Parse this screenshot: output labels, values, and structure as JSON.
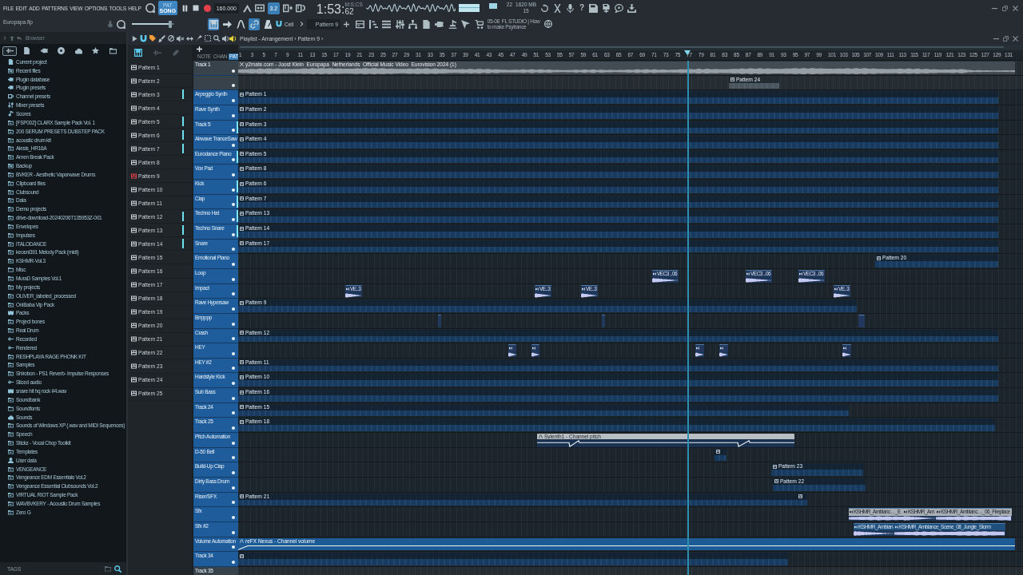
{
  "menu": [
    "FILE",
    "EDIT",
    "ADD",
    "PATTERNS",
    "VIEW",
    "OPTIONS",
    "TOOLS",
    "HELP"
  ],
  "transport": {
    "modes": [
      {
        "label": "PAT",
        "selected": false
      },
      {
        "label": "SONG",
        "selected": true
      }
    ],
    "tempo": "160.000",
    "toggle": {
      "label": "3.2",
      "on": true
    },
    "time": {
      "main": "1:53:",
      "fraction": "62",
      "unit": "M:S:CS"
    },
    "cpu": "22",
    "memory": "1620 MB",
    "voices": "15",
    "help": "?"
  },
  "project": {
    "file": "Europapa.flp",
    "master_volume": {
      "level": 0.9
    },
    "tools": [
      {
        "kind": "keyboard",
        "on": true
      },
      {
        "kind": "arrow",
        "on": false
      },
      {
        "kind": "curve",
        "on": false
      },
      {
        "kind": "link",
        "on": true
      },
      {
        "kind": "metronome",
        "on": false
      }
    ],
    "snap": "Cell",
    "pattern": "Pattern 9",
    "hint": [
      "05-08  FL STUDIO | How",
      "to make Psytrance"
    ]
  },
  "browser": {
    "title": "Browser",
    "tabs": [
      {
        "kind": "all",
        "selected": true
      },
      {
        "kind": "file",
        "selected": false
      },
      {
        "kind": "plug",
        "selected": false
      },
      {
        "kind": "disc",
        "selected": false
      },
      {
        "kind": "cloud",
        "selected": false
      },
      {
        "kind": "star",
        "selected": false
      },
      {
        "kind": "folderopen",
        "selected": false
      }
    ],
    "items": [
      {
        "label": "Current project",
        "kind": "project"
      },
      {
        "label": "Recent files",
        "kind": "recent"
      },
      {
        "label": "Plugin database",
        "kind": "plugin"
      },
      {
        "label": "Plugin presets",
        "kind": "plugin"
      },
      {
        "label": "Channel presets",
        "kind": "channel"
      },
      {
        "label": "Mixer presets",
        "kind": "mixer"
      },
      {
        "label": "Scores",
        "kind": "score"
      },
      {
        "label": "[FSP002] CLARX Sample Pack Vol. 1",
        "kind": "folder"
      },
      {
        "label": "200 SERUM PRESETS DUBSTEP PACK",
        "kind": "folder"
      },
      {
        "label": "acoustic drum kit",
        "kind": "folder"
      },
      {
        "label": "Alesis_HR16A",
        "kind": "folder"
      },
      {
        "label": "Amen Break Pack",
        "kind": "folder"
      },
      {
        "label": "Backup",
        "kind": "recent"
      },
      {
        "label": "BVKER - Aesthetic Vaporwave Drums",
        "kind": "folder"
      },
      {
        "label": "Clipboard files",
        "kind": "folder"
      },
      {
        "label": "Clubsound",
        "kind": "folder"
      },
      {
        "label": "Data",
        "kind": "folder"
      },
      {
        "label": "Demo projects",
        "kind": "folder"
      },
      {
        "label": "drive-download-20240206T135953Z-001",
        "kind": "folder"
      },
      {
        "label": "Envelopes",
        "kind": "folder"
      },
      {
        "label": "Impulses",
        "kind": "folder"
      },
      {
        "label": "ITALODANCE",
        "kind": "folder"
      },
      {
        "label": "keosni391 Melody Pack (midi)",
        "kind": "folder"
      },
      {
        "label": "KSHMR-Vol.3",
        "kind": "folder"
      },
      {
        "label": "Misc",
        "kind": "plain"
      },
      {
        "label": "MuraD Samples Vol.1",
        "kind": "folder"
      },
      {
        "label": "My projects",
        "kind": "folder"
      },
      {
        "label": "OLIVER_labeled_processed",
        "kind": "folder"
      },
      {
        "label": "OniBaba Vip Pack",
        "kind": "folder"
      },
      {
        "label": "Packs",
        "kind": "packs"
      },
      {
        "label": "Project bones",
        "kind": "folder"
      },
      {
        "label": "Real Drum",
        "kind": "folder"
      },
      {
        "label": "Recorded",
        "kind": "recorded"
      },
      {
        "label": "Rendered",
        "kind": "rendered"
      },
      {
        "label": "RESHPLAYA RAGE PHONK KIT",
        "kind": "folder"
      },
      {
        "label": "Samples",
        "kind": "folder"
      },
      {
        "label": "Shirobon - PS1 Reverb- Impulse Responses",
        "kind": "folder"
      },
      {
        "label": "Sliced audio",
        "kind": "recorded"
      },
      {
        "label": "snare hit hq rock #4.wav",
        "kind": "packs"
      },
      {
        "label": "Soundbank",
        "kind": "folder"
      },
      {
        "label": "Soundfonts",
        "kind": "plain"
      },
      {
        "label": "Sounds",
        "kind": "cloud"
      },
      {
        "label": "Sounds of Windows XP (.wav and MIDI Sequences)",
        "kind": "folder"
      },
      {
        "label": "Speech",
        "kind": "folder"
      },
      {
        "label": "Stickz - Vocal Chop Toolkit",
        "kind": "folder"
      },
      {
        "label": "Templates",
        "kind": "folder"
      },
      {
        "label": "User data",
        "kind": "user"
      },
      {
        "label": "VENGEANCE",
        "kind": "folder"
      },
      {
        "label": "Vengeance EDM Essentials Vol.2",
        "kind": "folder"
      },
      {
        "label": "Vengeance Essential Clubsounds Vol.2",
        "kind": "folder"
      },
      {
        "label": "VIRTUAL RIOT Sample Pack",
        "kind": "folder"
      },
      {
        "label": "WAVBVKERY - Acoustic Drum Samples",
        "kind": "folder"
      },
      {
        "label": "Zero G",
        "kind": "folder"
      }
    ],
    "footer": "TAGS"
  },
  "playlist": {
    "breadcrumb": "Playlist - Arrangement › Pattern 9 ›",
    "patterns": [
      {
        "label": "Pattern 1",
        "selected": false,
        "marked": false
      },
      {
        "label": "Pattern 2",
        "selected": false,
        "marked": false
      },
      {
        "label": "Pattern 3",
        "selected": false,
        "marked": true
      },
      {
        "label": "Pattern 4",
        "selected": false,
        "marked": false
      },
      {
        "label": "Pattern 5",
        "selected": false,
        "marked": true
      },
      {
        "label": "Pattern 6",
        "selected": false,
        "marked": true
      },
      {
        "label": "Pattern 7",
        "selected": false,
        "marked": true
      },
      {
        "label": "Pattern 8",
        "selected": false,
        "marked": false
      },
      {
        "label": "Pattern 9",
        "selected": true,
        "marked": false
      },
      {
        "label": "Pattern 10",
        "selected": false,
        "marked": false
      },
      {
        "label": "Pattern 11",
        "selected": false,
        "marked": false
      },
      {
        "label": "Pattern 12",
        "selected": false,
        "marked": true
      },
      {
        "label": "Pattern 13",
        "selected": false,
        "marked": true
      },
      {
        "label": "Pattern 14",
        "selected": false,
        "marked": true
      },
      {
        "label": "Pattern 15",
        "selected": false,
        "marked": false
      },
      {
        "label": "Pattern 16",
        "selected": false,
        "marked": false
      },
      {
        "label": "Pattern 17",
        "selected": false,
        "marked": false
      },
      {
        "label": "Pattern 18",
        "selected": false,
        "marked": false
      },
      {
        "label": "Pattern 19",
        "selected": false,
        "marked": false
      },
      {
        "label": "Pattern 20",
        "selected": false,
        "marked": false
      },
      {
        "label": "Pattern 21",
        "selected": false,
        "marked": false
      },
      {
        "label": "Pattern 22",
        "selected": false,
        "marked": false
      },
      {
        "label": "Pattern 23",
        "selected": false,
        "marked": false
      },
      {
        "label": "Pattern 24",
        "selected": false,
        "marked": false
      },
      {
        "label": "Pattern 25",
        "selected": false,
        "marked": false
      }
    ],
    "clip_sources": [
      {
        "label": "NOTE",
        "selected": false
      },
      {
        "label": "CHAN",
        "selected": false
      },
      {
        "label": "PAT",
        "selected": true
      }
    ],
    "ruler": [
      "1",
      "3",
      "5",
      "7",
      "9",
      "11",
      "13",
      "15",
      "17",
      "19",
      "21",
      "23",
      "25",
      "27",
      "29",
      "31",
      "33",
      "35",
      "37",
      "39",
      "41",
      "43",
      "45",
      "47",
      "49",
      "51",
      "53",
      "55",
      "57",
      "59",
      "61",
      "63",
      "65",
      "67",
      "69",
      "71",
      "73",
      "75",
      "77",
      "79",
      "81",
      "83",
      "85",
      "87",
      "89",
      "91",
      "93",
      "95",
      "97",
      "99",
      "101",
      "103",
      "105",
      "107",
      "109",
      "111",
      "113",
      "115",
      "117",
      "119",
      "121",
      "123",
      "125",
      "127",
      "129",
      "131"
    ],
    "tracks": [
      {
        "name": "Track 1",
        "color": "#38424a",
        "active": false,
        "clips": [
          {
            "kind": "audio",
            "label": "y2mate.com - Joost Klein  Europapa  Netherlands  Official Music Video  Eurovision 2024 (1)",
            "color": "#434c53"
          }
        ]
      },
      {
        "color": "#38424a",
        "active": false,
        "clips": [
          {
            "kind": "pattern",
            "label": "Pattern 24",
            "color": "#4b555d"
          }
        ]
      },
      {
        "name": "Arpeggio Synth",
        "color": "#1e5c9b",
        "active": false,
        "clips": [
          {
            "kind": "pattern",
            "label": "Pattern 1",
            "color": "#173a5e"
          }
        ]
      },
      {
        "name": "Rave Synth",
        "color": "#1e5c9b",
        "active": false,
        "clips": [
          {
            "kind": "pattern",
            "label": "Pattern 2",
            "color": "#173a5e"
          }
        ]
      },
      {
        "name": "Track 5",
        "color": "#1e5c9b",
        "active": true,
        "clips": [
          {
            "kind": "pattern",
            "label": "Pattern 3",
            "color": "#173a5e"
          }
        ]
      },
      {
        "name": "Airwave TranceSaw",
        "color": "#1e5c9b",
        "active": false,
        "clips": [
          {
            "kind": "pattern",
            "label": "Pattern 4",
            "color": "#173a5e"
          }
        ]
      },
      {
        "name": "Eurodance Piano",
        "color": "#1e5c9b",
        "active": true,
        "clips": [
          {
            "kind": "pattern",
            "label": "Pattern 5",
            "color": "#173a5e"
          }
        ]
      },
      {
        "name": "Vox Pad",
        "color": "#1e5c9b",
        "active": false,
        "clips": [
          {
            "kind": "pattern",
            "label": "Pattern 8",
            "color": "#173a5e"
          }
        ]
      },
      {
        "name": "Kick",
        "color": "#1e5c9b",
        "active": true,
        "clips": [
          {
            "kind": "pattern",
            "label": "Pattern 6",
            "color": "#173a5e"
          }
        ]
      },
      {
        "name": "Clap",
        "color": "#1e5c9b",
        "active": true,
        "clips": [
          {
            "kind": "pattern",
            "label": "Pattern 7",
            "color": "#173a5e"
          }
        ]
      },
      {
        "name": "Techno Hat",
        "color": "#1e5c9b",
        "active": true,
        "clips": [
          {
            "kind": "pattern",
            "label": "Pattern 13",
            "color": "#173a5e"
          }
        ]
      },
      {
        "name": "Techno Snare",
        "color": "#1e5c9b",
        "active": true,
        "clips": [
          {
            "kind": "pattern",
            "label": "Pattern 14",
            "color": "#173a5e"
          }
        ]
      },
      {
        "name": "Snare",
        "color": "#1e5c9b",
        "active": false,
        "clips": [
          {
            "kind": "pattern",
            "label": "Pattern 17",
            "color": "#173a5e"
          }
        ]
      },
      {
        "name": "Emotional Piano",
        "color": "#1e5c9b",
        "active": false,
        "clips": [
          {
            "kind": "pattern",
            "label": "Pattern 20",
            "color": "#173a5e"
          }
        ]
      },
      {
        "name": "Loop",
        "color": "#1e5c9b",
        "active": false,
        "clips": [
          {
            "kind": "sample",
            "label": "VEC3 ..06",
            "color": "#22385c"
          },
          {
            "kind": "sample",
            "label": "VEC3 ..06",
            "color": "#22385c"
          },
          {
            "kind": "sample",
            "label": "VEC3 ..06",
            "color": "#22385c"
          }
        ]
      },
      {
        "name": "Impact",
        "color": "#1e5c9b",
        "active": false,
        "clips": [
          {
            "kind": "sample",
            "label": "VE..3",
            "color": "#22385c"
          },
          {
            "kind": "sample",
            "label": "VE..3",
            "color": "#22385c"
          },
          {
            "kind": "sample",
            "label": "VE..3",
            "color": "#22385c"
          },
          {
            "kind": "sample",
            "label": "VE..3",
            "color": "#22385c"
          }
        ]
      },
      {
        "name": "Rave Hypersaw",
        "color": "#1e5c9b",
        "active": false,
        "clips": [
          {
            "kind": "pattern",
            "label": "Pattern 9",
            "color": "#173a5e"
          }
        ]
      },
      {
        "name": "Brrpppp",
        "color": "#1e5c9b",
        "active": false,
        "clips": [
          {
            "kind": "sample",
            "color": "#22385c"
          },
          {
            "kind": "sample",
            "color": "#22385c"
          },
          {
            "kind": "sample",
            "color": "#22385c"
          }
        ]
      },
      {
        "name": "Crash",
        "color": "#1e5c9b",
        "active": false,
        "clips": [
          {
            "kind": "pattern",
            "label": "Pattern 12",
            "color": "#173a5e"
          }
        ]
      },
      {
        "name": "HEY",
        "color": "#1e5c9b",
        "active": false,
        "clips": [
          {
            "kind": "sample",
            "color": "#22385c"
          },
          {
            "kind": "sample",
            "color": "#22385c"
          },
          {
            "kind": "sample",
            "color": "#22385c"
          },
          {
            "kind": "sample",
            "color": "#22385c"
          },
          {
            "kind": "sample",
            "color": "#22385c"
          }
        ]
      },
      {
        "name": "HEY #2",
        "color": "#1e5c9b",
        "active": false,
        "clips": [
          {
            "kind": "pattern",
            "label": "Pattern 11",
            "color": "#173a5e"
          }
        ]
      },
      {
        "name": "Hardstyle Kick",
        "color": "#1e5c9b",
        "active": false,
        "clips": [
          {
            "kind": "pattern",
            "label": "Pattern 10",
            "color": "#173a5e"
          }
        ]
      },
      {
        "name": "Sub Bass",
        "color": "#1e5c9b",
        "active": false,
        "clips": [
          {
            "kind": "pattern",
            "label": "Pattern 16",
            "color": "#173a5e"
          }
        ]
      },
      {
        "name": "Track 24",
        "color": "#1e5c9b",
        "active": false,
        "clips": [
          {
            "kind": "pattern",
            "label": "Pattern 15",
            "color": "#173a5e"
          }
        ]
      },
      {
        "name": "Track 25",
        "color": "#1e5c9b",
        "active": false,
        "clips": [
          {
            "kind": "pattern",
            "label": "Pattern 18",
            "color": "#173a5e"
          }
        ]
      },
      {
        "name": "Pitch Automation",
        "color": "#1e5c9b",
        "active": false,
        "clips": [
          {
            "kind": "automation",
            "label": "Sylenth1 - Channel pitch",
            "color": "#b9bec2"
          }
        ]
      },
      {
        "name": "D-50 Bell",
        "color": "#1e5c9b",
        "active": false,
        "clips": [
          {
            "kind": "pattern",
            "color": "#173a5e"
          }
        ]
      },
      {
        "name": "Build-Up Clap",
        "color": "#1e5c9b",
        "active": false,
        "clips": [
          {
            "kind": "pattern",
            "label": "Pattern 23",
            "color": "#173a5e"
          }
        ]
      },
      {
        "name": "Dirty Bass Drum",
        "color": "#1e5c9b",
        "active": false,
        "clips": [
          {
            "kind": "pattern",
            "label": "Pattern 22",
            "color": "#173a5e"
          }
        ]
      },
      {
        "name": "Riser/SFX",
        "color": "#1e5c9b",
        "active": false,
        "clips": [
          {
            "kind": "pattern",
            "label": "Pattern 21",
            "color": "#173a5e"
          },
          {
            "kind": "pattern",
            "color": "#173a5e"
          }
        ]
      },
      {
        "name": "Sfx",
        "color": "#1e5c9b",
        "active": false,
        "clips": [
          {
            "kind": "sample",
            "label": "KSHMR_Ambianc…_E",
            "color": "#a9b0b5"
          },
          {
            "kind": "sample",
            "label": "KSHMR_Am",
            "color": "#a9b0b5"
          },
          {
            "kind": "sample",
            "label": "KSHMR_Ambianc…_06_Fireplace",
            "color": "#a9b0b5"
          }
        ]
      },
      {
        "name": "Sfx #2",
        "color": "#1e5c9b",
        "active": false,
        "clips": [
          {
            "kind": "sample",
            "label": "KSHMR_Ambian",
            "color": "#1f4f7c"
          },
          {
            "kind": "sample",
            "label": "KSHMR_Ambiance_Scene_08_Jungle_Storm",
            "color": "#1f4f7c"
          }
        ]
      },
      {
        "name": "Volume Automation",
        "color": "#1e5c9b",
        "active": false,
        "clips": [
          {
            "kind": "automation",
            "label": "reFX Nexus - Channel volume",
            "color": "#1d5b96"
          }
        ]
      },
      {
        "name": "Track 34",
        "color": "#1e5c9b",
        "active": false,
        "clips": [
          {
            "kind": "pattern",
            "color": "#173a5e"
          }
        ]
      },
      {
        "name": "Track 35",
        "color": "#38424a",
        "active": false
      }
    ]
  }
}
